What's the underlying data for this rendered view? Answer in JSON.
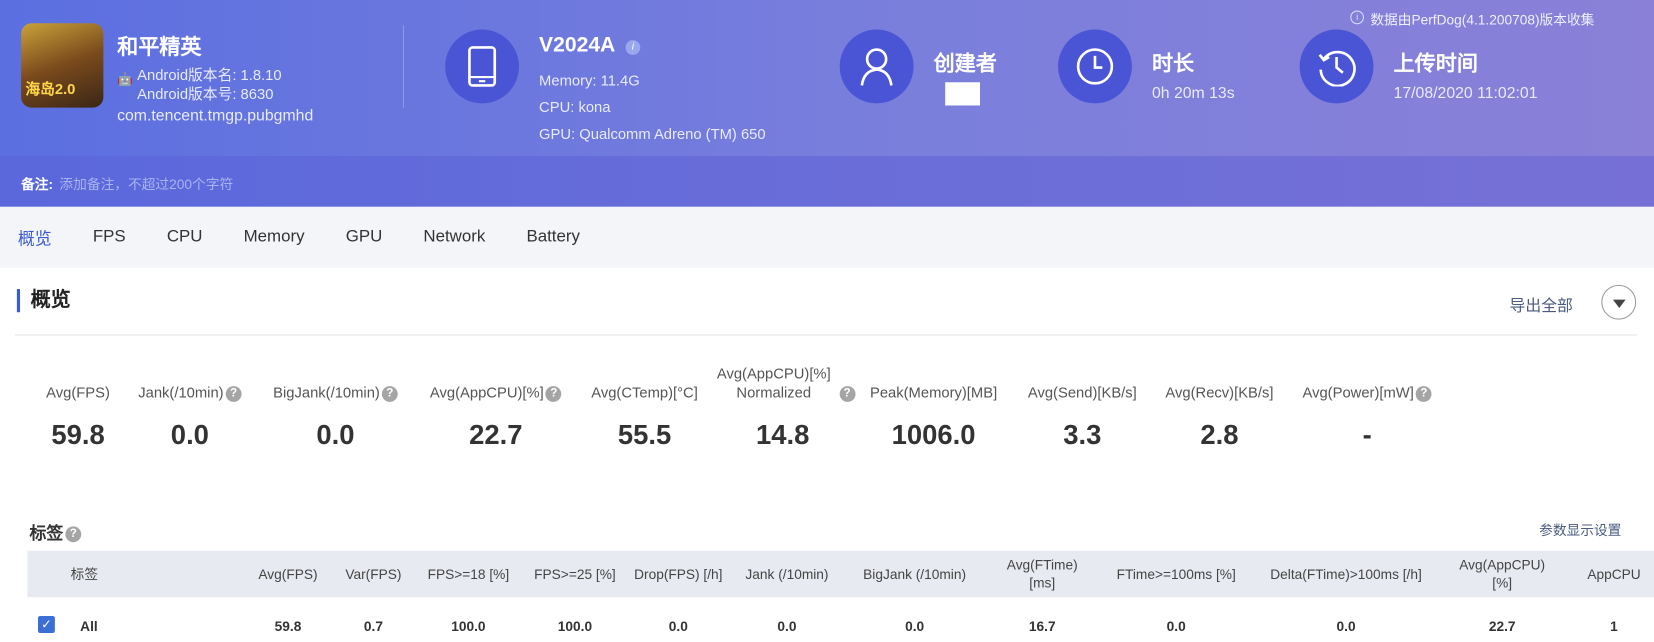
{
  "app": {
    "name": "和平精英",
    "version_name": "Android版本名: 1.8.10",
    "version_code": "Android版本号: 8630",
    "package": "com.tencent.tmgp.pubgmhd",
    "icon_text": "海岛2.0"
  },
  "device": {
    "model": "V2024A",
    "memory": "Memory: 11.4G",
    "cpu": "CPU: kona",
    "gpu": "GPU: Qualcomm Adreno (TM) 650"
  },
  "creator": {
    "label": "创建者"
  },
  "duration": {
    "label": "时长",
    "value": "0h 20m 13s"
  },
  "upload": {
    "label": "上传时间",
    "value": "17/08/2020 11:02:01"
  },
  "source_note": "数据由PerfDog(4.1.200708)版本收集",
  "note": {
    "label": "备注:",
    "placeholder": "添加备注，不超过200个字符"
  },
  "tabs": [
    "概览",
    "FPS",
    "CPU",
    "Memory",
    "GPU",
    "Network",
    "Battery"
  ],
  "section": {
    "title": "概览",
    "export": "导出全部"
  },
  "metrics": [
    {
      "label": "Avg(FPS)",
      "value": "59.8",
      "help": false
    },
    {
      "label": "Jank(/10min)",
      "value": "0.0",
      "help": true
    },
    {
      "label": "BigJank(/10min)",
      "value": "0.0",
      "help": true
    },
    {
      "label": "Avg(AppCPU)[%]",
      "value": "22.7",
      "help": true
    },
    {
      "label": "Avg(CTemp)[°C]",
      "value": "55.5",
      "help": false
    },
    {
      "label": "Avg(AppCPU)[%] Normalized",
      "value": "14.8",
      "help": true
    },
    {
      "label": "Peak(Memory)[MB]",
      "value": "1006.0",
      "help": false
    },
    {
      "label": "Avg(Send)[KB/s]",
      "value": "3.3",
      "help": false
    },
    {
      "label": "Avg(Recv)[KB/s]",
      "value": "2.8",
      "help": false
    },
    {
      "label": "Avg(Power)[mW]",
      "value": "-",
      "help": true
    }
  ],
  "tags": {
    "title": "标签",
    "settings": "参数显示设置",
    "columns": [
      "标签",
      "Avg(FPS)",
      "Var(FPS)",
      "FPS>=18 [%]",
      "FPS>=25 [%]",
      "Drop(FPS) [/h]",
      "Jank (/10min)",
      "BigJank (/10min)",
      "Avg(FTime) [ms]",
      "FTime>=100ms [%]",
      "Delta(FTime)>100ms [/h]",
      "Avg(AppCPU) [%]",
      "AppCPU"
    ],
    "rows": [
      {
        "checked": true,
        "cells": [
          "All",
          "59.8",
          "0.7",
          "100.0",
          "100.0",
          "0.0",
          "0.0",
          "0.0",
          "16.7",
          "0.0",
          "0.0",
          "22.7",
          "1"
        ]
      }
    ]
  },
  "colors": {
    "accent": "#3b5bd6",
    "header_start": "#5b6fe0",
    "header_end": "#8a80d8",
    "icon_circle": "#4a55d6"
  }
}
